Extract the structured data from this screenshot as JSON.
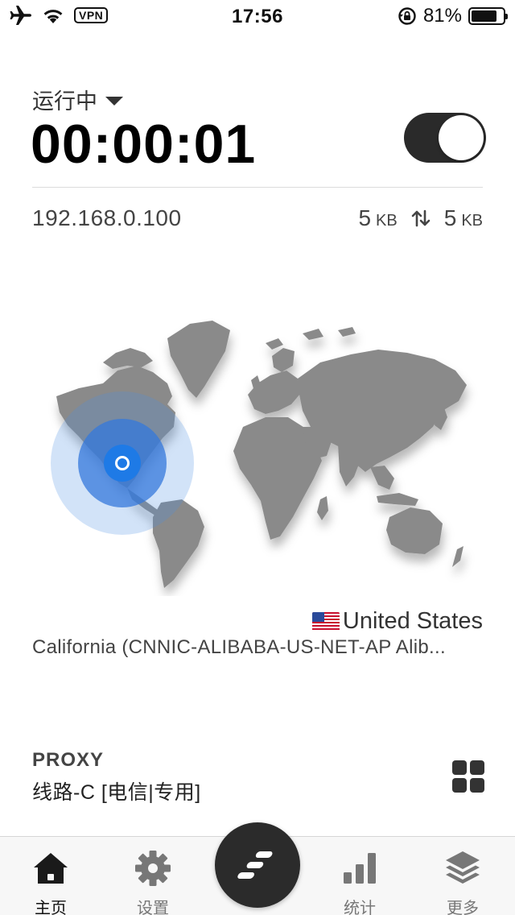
{
  "status_bar": {
    "vpn_label": "VPN",
    "time": "17:56",
    "battery": "81%",
    "battery_level": 0.81
  },
  "connection": {
    "status": "运行中",
    "timer": "00:00:01",
    "toggle_on": true,
    "ip": "192.168.0.100",
    "upload_value": "5",
    "upload_unit": "KB",
    "download_value": "5",
    "download_unit": "KB"
  },
  "location": {
    "flag": "us-flag",
    "country": "United States",
    "region": "California (CNNIC-ALIBABA-US-NET-AP Alib..."
  },
  "proxy": {
    "title": "PROXY",
    "line": "线路-C [电信|专用]"
  },
  "tabbar": {
    "tabs": [
      {
        "label": "主页",
        "icon": "home-icon",
        "active": true
      },
      {
        "label": "设置",
        "icon": "gear-icon",
        "active": false
      },
      {
        "label": "统计",
        "icon": "bar-chart-icon",
        "active": false
      },
      {
        "label": "更多",
        "icon": "layers-icon",
        "active": false
      }
    ],
    "center_icon": "logo-icon"
  },
  "colors": {
    "accent": "#1e7ae6",
    "toggle_bg": "#2a2a2a",
    "map_land": "#8a8a8a"
  }
}
